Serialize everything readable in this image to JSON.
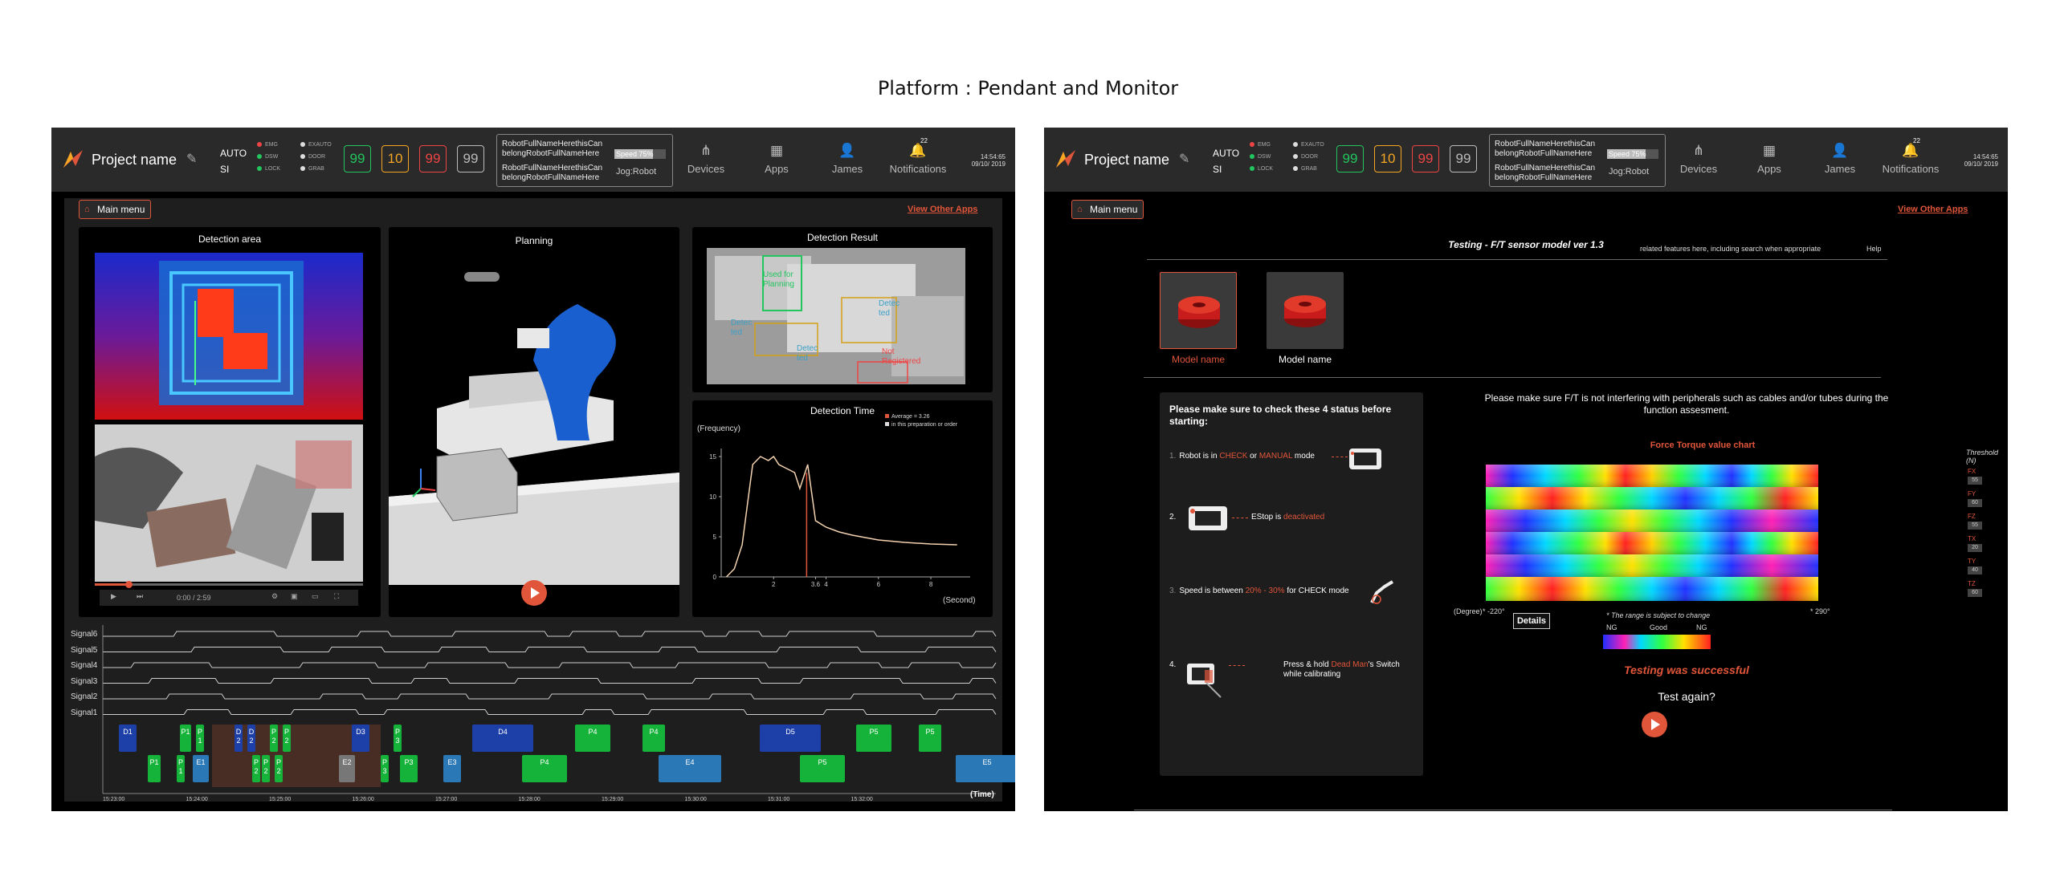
{
  "page_title": "Platform : Pendant and Monitor",
  "colors": {
    "accent": "#e1553a",
    "green": "#22c55e",
    "yellow": "#f5a623",
    "red": "#ef4444",
    "gray": "#bbbbbb"
  },
  "header": {
    "project_name": "Project name",
    "mode_line1": "AUTO",
    "mode_line2": "SI",
    "status_leds": [
      {
        "label": "EMG",
        "color": "#ef4444"
      },
      {
        "label": "DSW",
        "color": "#22c55e"
      },
      {
        "label": "LOCK",
        "color": "#22c55e"
      }
    ],
    "status_leds2": [
      {
        "label": "EXAUTO",
        "color": "#dddddd"
      },
      {
        "label": "DOOR",
        "color": "#dddddd"
      },
      {
        "label": "GRAB",
        "color": "#dddddd"
      }
    ],
    "counters": [
      {
        "value": "99",
        "color": "#22c55e"
      },
      {
        "value": "10",
        "color": "#f5a623"
      },
      {
        "value": "99",
        "color": "#ef4444"
      },
      {
        "value": "99",
        "color": "#bbbbbb"
      }
    ],
    "robot_name_1": "RobotFullNameHerethisCan belongRobotFullNameHere",
    "robot_name_2": "RobotFullNameHerethisCan belongRobotFullNameHere",
    "speed_label": "Speed 75%",
    "speed_fraction": 0.75,
    "jog_label": "Jog:Robot",
    "nav": [
      {
        "label": "Devices",
        "icon": "devices-icon"
      },
      {
        "label": "Apps",
        "icon": "apps-icon"
      },
      {
        "label": "James",
        "icon": "user-icon"
      },
      {
        "label": "Notifications",
        "icon": "bell-icon"
      }
    ],
    "notification_count": "22",
    "time": "14:54:65",
    "date": "09/10/ 2019"
  },
  "left": {
    "main_menu": "Main menu",
    "view_other_apps": "View Other Apps",
    "detection_area_title": "Detection area",
    "planning_title": "Planning",
    "detection_result_title": "Detection Result",
    "detection_labels": [
      "Used for Planning",
      "Detec ted",
      "Detec ted",
      "Detec ted",
      "Not Registered"
    ],
    "video_time": "0:00 / 2:59",
    "detection_time_title": "Detection Time",
    "legend": [
      "Average = 3.26",
      "in this preparation or order"
    ],
    "signals": [
      "Signal6",
      "Signal5",
      "Signal4",
      "Signal3",
      "Signal2",
      "Signal1"
    ],
    "time_ticks": [
      "15:23:00",
      "15:24:00",
      "15:25:00",
      "15:26:00",
      "15:27:00",
      "15:28:00",
      "15:29:00",
      "15:30:00",
      "15:31:00",
      "15:32:00"
    ],
    "time_label": "(Time)",
    "blocks_row1": [
      {
        "label": "D1",
        "color": "#1d3fa8"
      },
      {
        "label": "P1",
        "color": "#16b33a"
      },
      {
        "label": "P 1",
        "color": "#16b33a"
      },
      {
        "label": "D 2",
        "color": "#1d3fa8"
      },
      {
        "label": "D 2",
        "color": "#1d3fa8"
      },
      {
        "label": "P 2",
        "color": "#16b33a"
      },
      {
        "label": "P 2",
        "color": "#16b33a"
      },
      {
        "label": "D3",
        "color": "#1d3fa8"
      },
      {
        "label": "P 3",
        "color": "#16b33a"
      },
      {
        "label": "D4",
        "color": "#1d3fa8"
      },
      {
        "label": "P4",
        "color": "#16b33a"
      },
      {
        "label": "P4",
        "color": "#16b33a"
      },
      {
        "label": "D5",
        "color": "#1d3fa8"
      },
      {
        "label": "P5",
        "color": "#16b33a"
      },
      {
        "label": "P5",
        "color": "#16b33a"
      }
    ],
    "blocks_row2": [
      {
        "label": "P1",
        "color": "#16b33a"
      },
      {
        "label": "P 1",
        "color": "#16b33a"
      },
      {
        "label": "E1",
        "color": "#2a78b5"
      },
      {
        "label": "P 2",
        "color": "#16b33a"
      },
      {
        "label": "P 2",
        "color": "#16b33a"
      },
      {
        "label": "P 2",
        "color": "#16b33a"
      },
      {
        "label": "E2",
        "color": "#777777"
      },
      {
        "label": "P 3",
        "color": "#16b33a"
      },
      {
        "label": "P3",
        "color": "#16b33a"
      },
      {
        "label": "E3",
        "color": "#2a78b5"
      },
      {
        "label": "P4",
        "color": "#16b33a"
      },
      {
        "label": "E4",
        "color": "#2a78b5"
      },
      {
        "label": "P5",
        "color": "#16b33a"
      },
      {
        "label": "E5",
        "color": "#2a78b5"
      }
    ]
  },
  "chart_data": {
    "type": "line",
    "title": "Detection Time",
    "ylabel": "(Frequency)",
    "xlabel": "(Second)",
    "y_ticks": [
      "0",
      "5",
      "10",
      "15"
    ],
    "x_ticks": [
      "2",
      "3.6",
      "4",
      "6",
      "8"
    ],
    "x": [
      0.2,
      0.5,
      0.8,
      1.0,
      1.2,
      1.5,
      1.8,
      2.0,
      2.2,
      2.5,
      2.8,
      3.0,
      3.3,
      3.6,
      4.0,
      4.5,
      5.0,
      6.0,
      7.0,
      8.0,
      9.0
    ],
    "values": [
      0,
      1,
      4,
      9,
      14,
      15,
      14.5,
      15,
      14,
      13.5,
      13,
      11,
      14,
      7,
      6.2,
      5.6,
      5.2,
      4.6,
      4.3,
      4.1,
      4.0
    ],
    "xlim": [
      0,
      9.5
    ],
    "ylim": [
      0,
      16
    ],
    "average": 3.26
  },
  "right": {
    "main_menu": "Main menu",
    "view_other_apps": "View Other Apps",
    "test_title": "Testing  - F/T sensor model  ver 1.3",
    "related_text": "related  features here, including search when appropriate",
    "help": "Help",
    "models": [
      "Model name",
      "Model name"
    ],
    "checklist_title": "Please make sure to check these 4 status before starting:",
    "step1": {
      "num": "1.",
      "a": "Robot is in ",
      "b": "CHECK",
      "c": " or ",
      "d": "MANUAL",
      "e": " mode"
    },
    "step2": {
      "num": "2.",
      "a": "EStop is ",
      "b": "deactivated"
    },
    "step3": {
      "num": "3.",
      "a": "Speed is between ",
      "b": "20% - 30%",
      "c": " for CHECK mode"
    },
    "step4": {
      "num": "4.",
      "a": "Press & hold ",
      "b": "Dead Man",
      "c": "'s Switch while calibrating"
    },
    "note": "Please make sure F/T is not interfering with peripherals such as cables and/or tubes during the function assesment.",
    "ft_title": "Force Torque value chart",
    "threshold_label": "Threshold (N)",
    "thresholds": [
      {
        "axis": "FX",
        "value": "55"
      },
      {
        "axis": "FY",
        "value": "60"
      },
      {
        "axis": "FZ",
        "value": "55"
      },
      {
        "axis": "TX",
        "value": "20"
      },
      {
        "axis": "TY",
        "value": "40"
      },
      {
        "axis": "TZ",
        "value": "60"
      }
    ],
    "degree_label": "(Degree)",
    "deg_min": "* -220°",
    "deg_max": "* 290°",
    "details": "Details",
    "range_note": "* The range is subject to change",
    "ng_left": "NG",
    "good": "Good",
    "ng_right": "NG",
    "success": "Testing was successful",
    "again": "Test again?"
  }
}
